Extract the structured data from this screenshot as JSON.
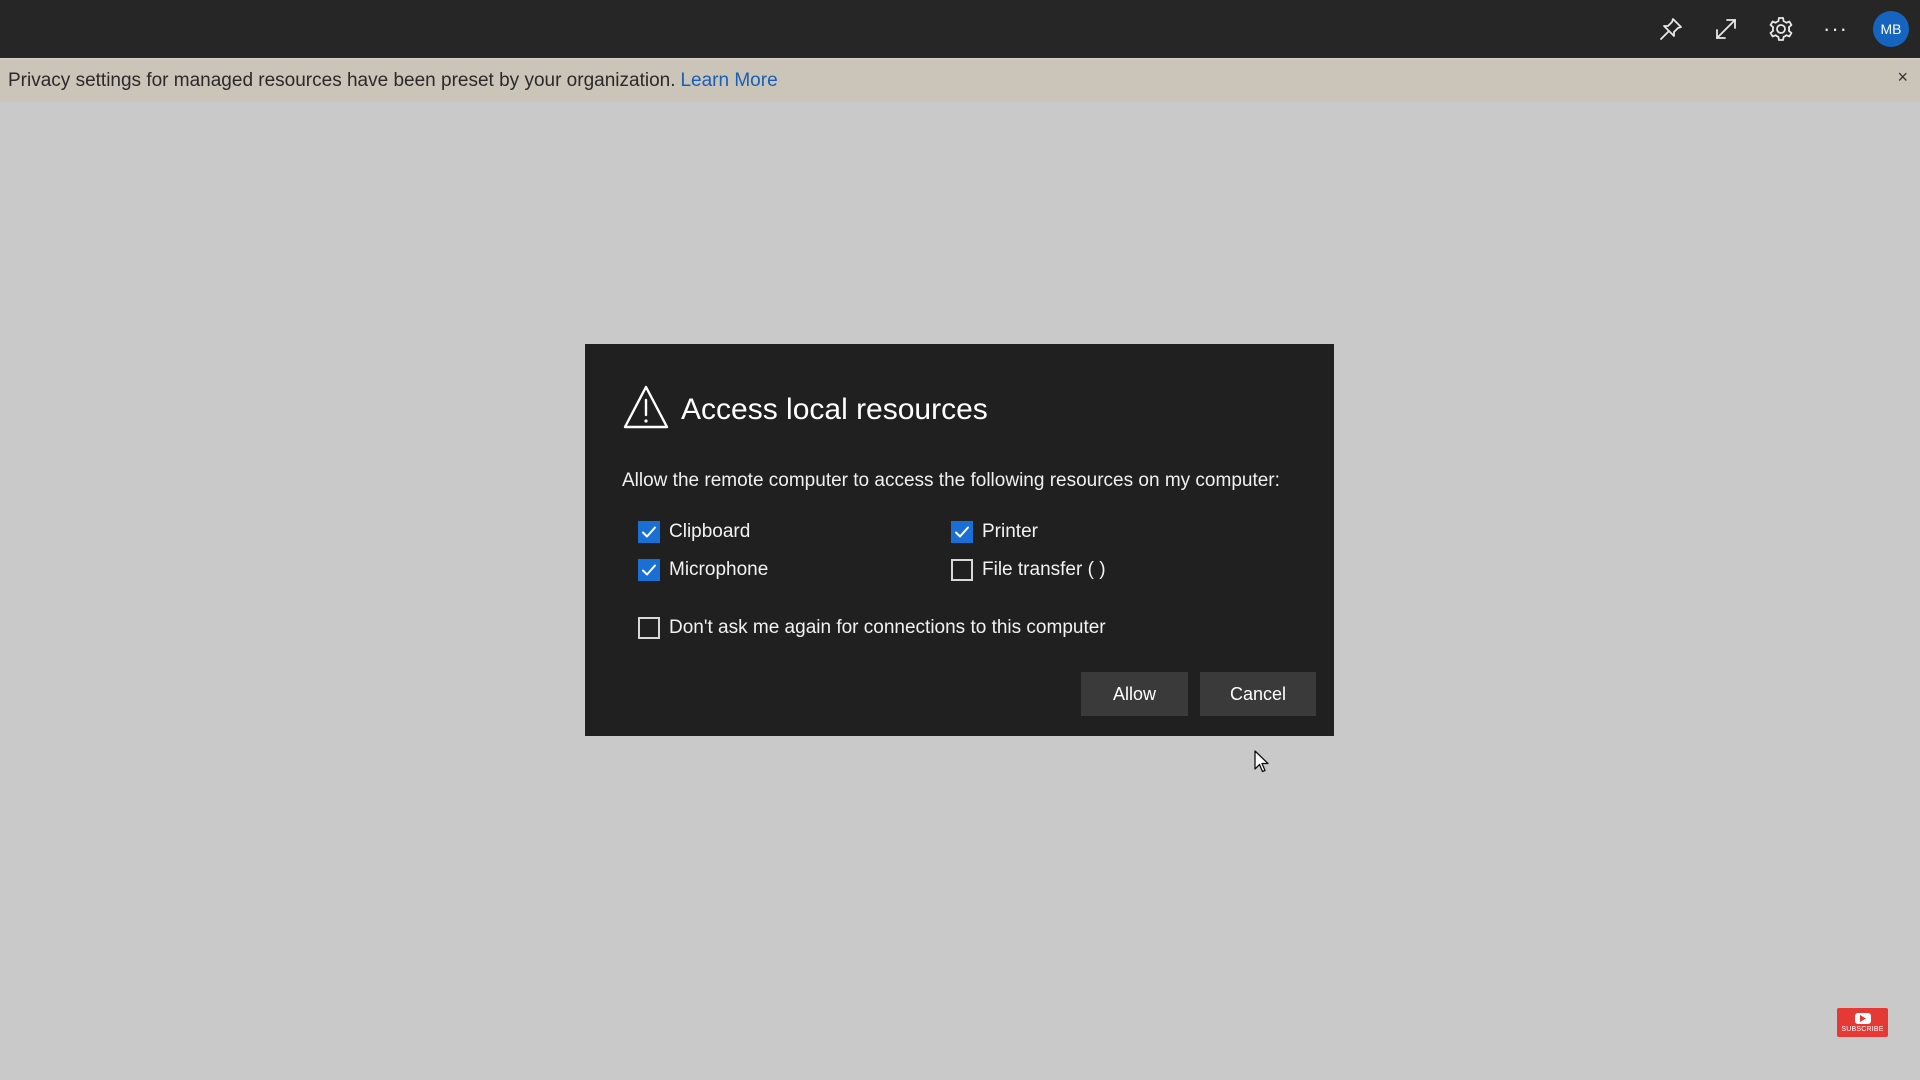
{
  "toolbar": {
    "icons": [
      "pin-icon",
      "expand-icon",
      "gear-icon",
      "more-icon"
    ],
    "more_glyph": "···",
    "avatar_initials": "MB",
    "avatar_color": "#1565c0"
  },
  "banner": {
    "message": "Privacy settings for managed resources have been preset by your organization.",
    "link_text": "Learn More",
    "close_glyph": "×",
    "link_color": "#1a5fb4"
  },
  "dialog": {
    "title": "Access local resources",
    "description": "Allow the remote computer to access the following resources on my computer:",
    "resources": [
      {
        "label": "Clipboard",
        "checked": true
      },
      {
        "label": "Printer",
        "checked": true
      },
      {
        "label": "Microphone",
        "checked": true
      },
      {
        "label": "File transfer ( )",
        "checked": false
      }
    ],
    "dont_ask": {
      "label": "Don't ask me again for connections to this computer",
      "checked": false
    },
    "allow_label": "Allow",
    "cancel_label": "Cancel",
    "accent_color": "#1a6fd4"
  },
  "subscribe": {
    "label": "SUBSCRIBE",
    "color": "#e53935"
  }
}
